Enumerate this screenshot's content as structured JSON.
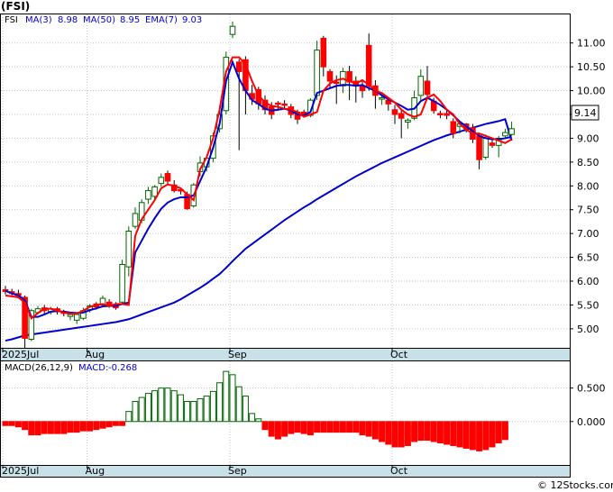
{
  "chart_data": {
    "type": "candlestick",
    "ticker_label": "(FSI)",
    "price_panel": {
      "legend": [
        {
          "label": "FSI",
          "color": "#000000"
        },
        {
          "label": "MA(3)",
          "value": "8.98",
          "color": "#cc0000"
        },
        {
          "label": "MA(50)",
          "value": "8.95",
          "color": "#0000cc"
        },
        {
          "label": "EMA(7)",
          "value": "9.03",
          "color": "#0000cc"
        }
      ],
      "y_ticks": [
        "5.00",
        "5.50",
        "6.00",
        "6.50",
        "7.00",
        "7.50",
        "8.00",
        "8.50",
        "9.00",
        "9.50",
        "10.00",
        "10.50",
        "11.00"
      ],
      "y_range": [
        4.6,
        11.6
      ],
      "last_price": "9.14",
      "candles": [
        [
          5.82,
          5.78,
          5.9,
          5.72
        ],
        [
          5.78,
          5.74,
          5.84,
          5.7
        ],
        [
          5.74,
          5.7,
          5.82,
          5.64
        ],
        [
          5.66,
          4.8,
          5.7,
          4.6
        ],
        [
          4.78,
          5.38,
          5.42,
          4.74
        ],
        [
          5.34,
          5.42,
          5.48,
          5.3
        ],
        [
          5.44,
          5.38,
          5.5,
          5.32
        ],
        [
          5.36,
          5.42,
          5.46,
          5.3
        ],
        [
          5.42,
          5.36,
          5.46,
          5.3
        ],
        [
          5.36,
          5.32,
          5.4,
          5.26
        ],
        [
          5.26,
          5.3,
          5.34,
          5.18
        ],
        [
          5.18,
          5.3,
          5.34,
          5.1
        ],
        [
          5.22,
          5.38,
          5.44,
          5.18
        ],
        [
          5.4,
          5.48,
          5.52,
          5.34
        ],
        [
          5.52,
          5.46,
          5.56,
          5.4
        ],
        [
          5.5,
          5.64,
          5.7,
          5.46
        ],
        [
          5.56,
          5.48,
          5.62,
          5.44
        ],
        [
          5.5,
          5.44,
          5.56,
          5.4
        ],
        [
          5.56,
          6.35,
          6.45,
          5.52
        ],
        [
          6.3,
          7.05,
          7.15,
          6.1
        ],
        [
          7.15,
          7.42,
          7.55,
          7.1
        ],
        [
          7.28,
          7.65,
          7.72,
          7.22
        ],
        [
          7.72,
          7.9,
          7.98,
          7.62
        ],
        [
          7.78,
          7.98,
          8.02,
          7.7
        ],
        [
          8.05,
          8.18,
          8.26,
          7.98
        ],
        [
          8.26,
          8.1,
          8.32,
          8.02
        ],
        [
          8.02,
          7.9,
          8.12,
          7.86
        ],
        [
          7.92,
          7.9,
          7.96,
          7.82
        ],
        [
          7.82,
          7.52,
          7.88,
          7.5
        ],
        [
          7.58,
          8.02,
          8.06,
          7.54
        ],
        [
          8.3,
          8.48,
          8.62,
          8.2
        ],
        [
          8.4,
          8.58,
          8.62,
          8.3
        ],
        [
          8.58,
          9.05,
          9.12,
          8.5
        ],
        [
          9.2,
          9.5,
          9.68,
          9.12
        ],
        [
          9.58,
          10.7,
          10.82,
          9.5
        ],
        [
          11.18,
          11.35,
          11.45,
          11.1
        ],
        [
          10.6,
          10.4,
          10.66,
          8.75
        ],
        [
          10.65,
          10.0,
          10.72,
          9.5
        ],
        [
          9.94,
          9.82,
          10.12,
          9.7
        ],
        [
          10.02,
          9.72,
          10.08,
          9.6
        ],
        [
          9.8,
          9.6,
          9.9,
          9.5
        ],
        [
          9.66,
          9.5,
          9.76,
          9.4
        ],
        [
          9.74,
          9.72,
          9.78,
          9.58
        ],
        [
          9.72,
          9.7,
          9.8,
          9.62
        ],
        [
          9.66,
          9.5,
          9.72,
          9.42
        ],
        [
          9.55,
          9.4,
          9.6,
          9.3
        ],
        [
          9.55,
          9.5,
          9.6,
          9.45
        ],
        [
          9.48,
          9.8,
          9.84,
          9.44
        ],
        [
          9.9,
          10.85,
          11.05,
          9.8
        ],
        [
          11.1,
          10.5,
          11.15,
          10.3
        ],
        [
          10.4,
          10.2,
          10.45,
          10.05
        ],
        [
          10.18,
          10.16,
          10.32,
          9.72
        ],
        [
          10.1,
          10.4,
          10.48,
          9.95
        ],
        [
          10.4,
          10.18,
          10.52,
          9.8
        ],
        [
          10.2,
          10.1,
          10.3,
          9.75
        ],
        [
          10.1,
          10.0,
          10.22,
          9.85
        ],
        [
          10.95,
          10.1,
          11.2,
          10.0
        ],
        [
          10.1,
          9.9,
          10.22,
          9.62
        ],
        [
          9.82,
          9.85,
          9.9,
          9.7
        ],
        [
          9.8,
          9.72,
          9.86,
          9.58
        ],
        [
          9.6,
          9.5,
          9.7,
          9.3
        ],
        [
          9.52,
          9.42,
          9.6,
          9.0
        ],
        [
          9.34,
          9.38,
          9.42,
          9.2
        ],
        [
          9.42,
          9.85,
          10.0,
          9.38
        ],
        [
          9.9,
          10.3,
          10.45,
          9.8
        ],
        [
          10.2,
          9.92,
          10.52,
          9.82
        ],
        [
          9.78,
          9.58,
          9.85,
          9.52
        ],
        [
          9.52,
          9.5,
          9.58,
          9.42
        ],
        [
          9.52,
          9.48,
          9.6,
          9.4
        ],
        [
          9.35,
          9.1,
          9.42,
          9.0
        ],
        [
          9.25,
          9.3,
          9.32,
          9.1
        ],
        [
          9.3,
          9.2,
          9.32,
          9.12
        ],
        [
          9.22,
          8.98,
          9.3,
          8.9
        ],
        [
          9.05,
          8.55,
          9.1,
          8.35
        ],
        [
          8.6,
          9.0,
          9.08,
          8.55
        ],
        [
          8.9,
          8.85,
          9.0,
          8.8
        ],
        [
          8.85,
          9.0,
          9.05,
          8.6
        ],
        [
          9.05,
          9.12,
          9.2,
          9.0
        ],
        [
          9.08,
          9.2,
          9.35,
          9.05
        ]
      ],
      "ma3": [
        5.7,
        5.68,
        5.66,
        5.55,
        5.22,
        5.33,
        5.42,
        5.42,
        5.38,
        5.34,
        5.32,
        5.32,
        5.38,
        5.46,
        5.5,
        5.52,
        5.48,
        5.52,
        5.52,
        5.5,
        6.95,
        7.3,
        7.5,
        7.7,
        7.95,
        8.03,
        8.0,
        7.95,
        7.82,
        7.7,
        8.35,
        8.6,
        9.0,
        9.6,
        10.4,
        10.7,
        10.7,
        10.55,
        10.2,
        9.9,
        9.75,
        9.68,
        9.66,
        9.62,
        9.6,
        9.55,
        9.45,
        9.5,
        9.55,
        10.0,
        10.15,
        10.22,
        10.25,
        10.2,
        10.15,
        10.22,
        10.12,
        10.0,
        9.95,
        9.85,
        9.75,
        9.6,
        9.5,
        9.45,
        9.5,
        9.85,
        9.92,
        9.78,
        9.6,
        9.5,
        9.3,
        9.18,
        9.1,
        9.1,
        9.05,
        9.0,
        8.95,
        8.9,
        8.98
      ],
      "ema7": [
        5.8,
        5.74,
        5.7,
        5.6,
        5.25,
        5.25,
        5.3,
        5.36,
        5.37,
        5.36,
        5.34,
        5.33,
        5.34,
        5.39,
        5.43,
        5.47,
        5.48,
        5.48,
        5.52,
        5.55,
        6.6,
        6.85,
        7.1,
        7.32,
        7.52,
        7.65,
        7.72,
        7.76,
        7.76,
        7.8,
        8.1,
        8.4,
        8.8,
        9.3,
        10.2,
        10.6,
        10.25,
        10.0,
        9.8,
        9.72,
        9.62,
        9.58,
        9.6,
        9.62,
        9.58,
        9.5,
        9.48,
        9.55,
        9.95,
        10.0,
        10.05,
        10.1,
        10.12,
        10.12,
        10.1,
        10.12,
        10.05,
        10.0,
        9.9,
        9.82,
        9.75,
        9.68,
        9.6,
        9.62,
        9.78,
        9.85,
        9.78,
        9.7,
        9.6,
        9.48,
        9.35,
        9.25,
        9.15,
        9.05,
        9.0,
        8.98,
        8.98,
        9.0,
        9.03
      ],
      "ma50": [
        4.75,
        4.78,
        4.82,
        4.86,
        4.88,
        4.9,
        4.92,
        4.94,
        4.96,
        4.98,
        5.0,
        5.02,
        5.04,
        5.06,
        5.08,
        5.1,
        5.12,
        5.14,
        5.17,
        5.2,
        5.25,
        5.3,
        5.35,
        5.4,
        5.45,
        5.5,
        5.55,
        5.62,
        5.7,
        5.78,
        5.86,
        5.95,
        6.05,
        6.15,
        6.28,
        6.42,
        6.55,
        6.68,
        6.78,
        6.88,
        6.98,
        7.08,
        7.18,
        7.28,
        7.37,
        7.46,
        7.55,
        7.63,
        7.72,
        7.8,
        7.88,
        7.96,
        8.04,
        8.12,
        8.2,
        8.27,
        8.34,
        8.41,
        8.48,
        8.54,
        8.6,
        8.66,
        8.72,
        8.78,
        8.84,
        8.9,
        8.96,
        9.01,
        9.06,
        9.1,
        9.14,
        9.18,
        9.22,
        9.26,
        9.3,
        9.33,
        9.36,
        9.4,
        8.95
      ]
    },
    "macd_panel": {
      "legend": [
        {
          "label": "MACD(26,12,9)",
          "color": "#000000"
        },
        {
          "label": "MACD:",
          "value": "-0.268",
          "color": "#0000cc"
        }
      ],
      "y_ticks": [
        "0.500",
        "0.000"
      ],
      "y_range": [
        -0.65,
        0.9
      ],
      "histogram": [
        -0.06,
        -0.06,
        -0.08,
        -0.12,
        -0.2,
        -0.2,
        -0.18,
        -0.18,
        -0.18,
        -0.18,
        -0.16,
        -0.16,
        -0.14,
        -0.14,
        -0.12,
        -0.1,
        -0.08,
        -0.06,
        -0.06,
        0.15,
        0.3,
        0.36,
        0.42,
        0.46,
        0.5,
        0.5,
        0.46,
        0.4,
        0.3,
        0.3,
        0.34,
        0.38,
        0.45,
        0.58,
        0.75,
        0.7,
        0.52,
        0.38,
        0.12,
        0.04,
        -0.12,
        -0.22,
        -0.26,
        -0.22,
        -0.18,
        -0.16,
        -0.18,
        -0.2,
        -0.16,
        -0.16,
        -0.16,
        -0.16,
        -0.16,
        -0.16,
        -0.16,
        -0.2,
        -0.22,
        -0.26,
        -0.3,
        -0.34,
        -0.38,
        -0.38,
        -0.36,
        -0.3,
        -0.28,
        -0.28,
        -0.3,
        -0.32,
        -0.34,
        -0.36,
        -0.38,
        -0.4,
        -0.42,
        -0.44,
        -0.42,
        -0.38,
        -0.32,
        -0.27
      ]
    },
    "x_labels": [
      {
        "label": "2025Jul",
        "index": 0
      },
      {
        "label": "Aug",
        "index": 13
      },
      {
        "label": "Sep",
        "index": 35
      },
      {
        "label": "Oct",
        "index": 60
      }
    ],
    "colors": {
      "up": "#006600",
      "down": "#ff0000",
      "ma3": "#ff0000",
      "ema7": "#0000cc",
      "ma50": "#0000cc",
      "macd_pos": "#006600",
      "macd_neg": "#ff0000",
      "axis_band": "#c8e0e8"
    },
    "watermark": "© 12Stocks.com"
  }
}
